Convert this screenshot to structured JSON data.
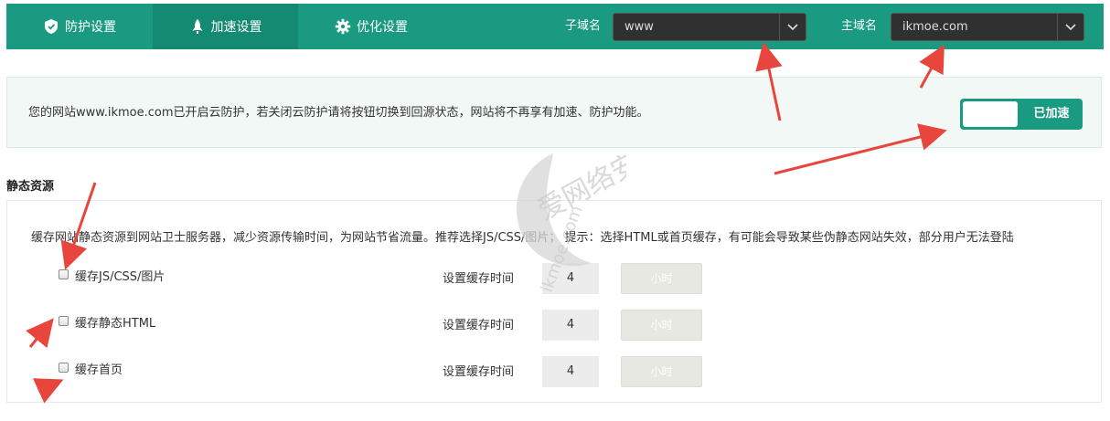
{
  "nav": {
    "tabs": [
      {
        "label": "防护设置",
        "icon": "shield-icon"
      },
      {
        "label": "加速设置",
        "icon": "rocket-icon"
      },
      {
        "label": "优化设置",
        "icon": "gear-icon"
      }
    ],
    "subdomain": {
      "label": "子域名",
      "value": "www"
    },
    "domain": {
      "label": "主域名",
      "value": "ikmoe.com"
    }
  },
  "banner": {
    "text": "您的网站www.ikmoe.com已开启云防护，若关闭云防护请将按钮切换到回源状态，网站将不再享有加速、防护功能。",
    "toggle_label": "已加速"
  },
  "static": {
    "title": "静态资源",
    "description": "缓存网站静态资源到网站卫士服务器，减少资源传输时间，为网站节省流量。推荐选择JS/CSS/图片； 提示：选择HTML或首页缓存，有可能会导致某些伪静态网站失效，部分用户无法登陆",
    "rows": [
      {
        "label": "缓存JS/CSS/图片",
        "time_label": "设置缓存时间",
        "value": "4",
        "unit": "小时",
        "checked": false
      },
      {
        "label": "缓存静态HTML",
        "time_label": "设置缓存时间",
        "value": "4",
        "unit": "小时",
        "checked": false
      },
      {
        "label": "缓存首页",
        "time_label": "设置缓存时间",
        "value": "4",
        "unit": "小时",
        "checked": false
      }
    ]
  },
  "watermark": {
    "text": "爱网络安全",
    "url": "ikmoe.com"
  },
  "colors": {
    "accent": "#1a9a80",
    "accent_dark": "#158a72",
    "arrow": "#e8453c"
  }
}
